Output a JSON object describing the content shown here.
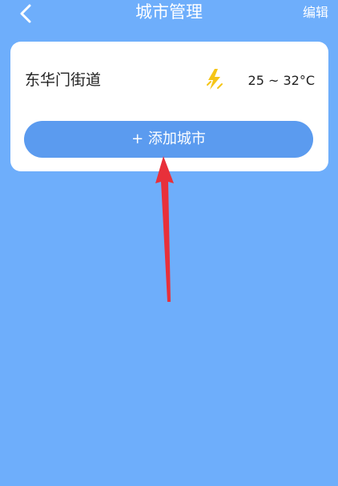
{
  "header": {
    "title": "城市管理",
    "edit_label": "编辑",
    "back_icon": "chevron-left-icon"
  },
  "city_list": [
    {
      "name": "东华门街道",
      "weather_icon": "thunder-icon",
      "temperature": "25 ~ 32°C"
    }
  ],
  "add_button": {
    "label": "+ 添加城市"
  },
  "colors": {
    "background": "#6eaefb",
    "button": "#5b9bef",
    "annotation_arrow": "#e8303a",
    "weather_icon": "#f5c518"
  }
}
